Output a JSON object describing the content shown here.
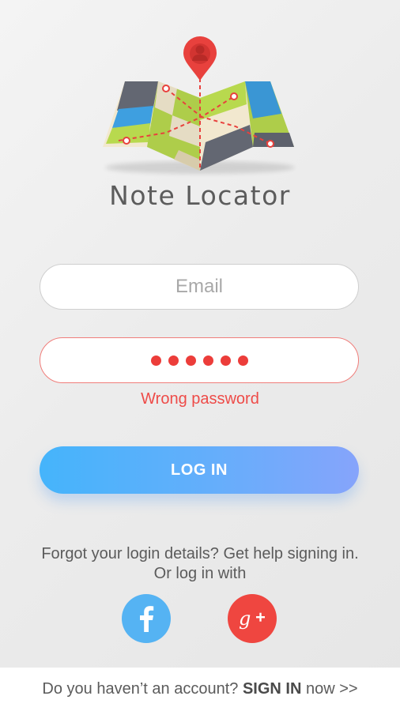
{
  "app": {
    "title": "Note Locator"
  },
  "form": {
    "email_placeholder": "Email",
    "email_value": "",
    "password_masked_length": 6,
    "error_message": "Wrong password",
    "login_label": "LOG IN"
  },
  "help": {
    "forgot_text": "Forgot your login details? Get help signing in.",
    "or_text": "Or log in with"
  },
  "social": {
    "facebook_icon": "facebook-icon",
    "google_icon": "google-plus-icon",
    "facebook_color": "#55b3f3",
    "google_color": "#ef4640"
  },
  "footer": {
    "prefix": "Do you haven’t an account? ",
    "link": "SIGN IN",
    "suffix": " now >>"
  },
  "colors": {
    "accent_start": "#45b4fb",
    "accent_end": "#86a4fb",
    "error": "#ee4b48"
  }
}
